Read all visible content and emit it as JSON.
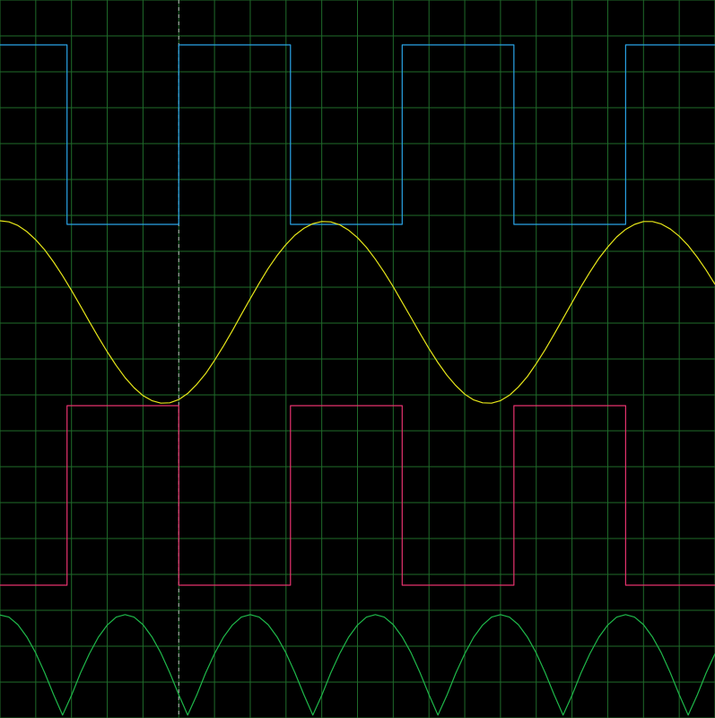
{
  "background_color": "#000000",
  "grid_color": "#1f6b2a",
  "cursor_color": "#bbbbbb",
  "chart_data": {
    "type": "line",
    "grid": true,
    "grid_divisions": {
      "x": 20,
      "y": 20
    },
    "cursor_x": 5,
    "xlim": [
      0,
      20
    ],
    "ylim": [
      0,
      20
    ],
    "series": [
      {
        "id": "square-blue",
        "color": "#29a3e6",
        "points": [
          [
            0,
            18.75
          ],
          [
            1.875,
            18.75
          ],
          [
            1.875,
            13.75
          ],
          [
            5,
            13.75
          ],
          [
            5,
            18.75
          ],
          [
            8.125,
            18.75
          ],
          [
            8.125,
            13.75
          ],
          [
            11.25,
            13.75
          ],
          [
            11.25,
            18.75
          ],
          [
            14.375,
            18.75
          ],
          [
            14.375,
            13.75
          ],
          [
            17.5,
            13.75
          ],
          [
            17.5,
            18.75
          ],
          [
            20,
            18.75
          ]
        ]
      },
      {
        "id": "sine-yellow",
        "color": "#e6e619",
        "points": [
          [
            0.0,
            13.85
          ],
          [
            0.25,
            13.82
          ],
          [
            0.5,
            13.72
          ],
          [
            0.75,
            13.55
          ],
          [
            1.0,
            13.32
          ],
          [
            1.25,
            13.04
          ],
          [
            1.5,
            12.7
          ],
          [
            1.75,
            12.32
          ],
          [
            2.0,
            11.91
          ],
          [
            2.25,
            11.48
          ],
          [
            2.5,
            11.04
          ],
          [
            2.75,
            10.61
          ],
          [
            3.0,
            10.2
          ],
          [
            3.25,
            9.82
          ],
          [
            3.5,
            9.48
          ],
          [
            3.75,
            9.2
          ],
          [
            4.0,
            8.98
          ],
          [
            4.25,
            8.84
          ],
          [
            4.5,
            8.77
          ],
          [
            4.75,
            8.78
          ],
          [
            5.0,
            8.87
          ],
          [
            5.25,
            9.04
          ],
          [
            5.5,
            9.29
          ],
          [
            5.75,
            9.59
          ],
          [
            6.0,
            9.96
          ],
          [
            6.25,
            10.36
          ],
          [
            6.5,
            10.79
          ],
          [
            6.75,
            11.24
          ],
          [
            7.0,
            11.68
          ],
          [
            7.25,
            12.11
          ],
          [
            7.5,
            12.52
          ],
          [
            7.75,
            12.88
          ],
          [
            8.0,
            13.19
          ],
          [
            8.25,
            13.45
          ],
          [
            8.5,
            13.64
          ],
          [
            8.75,
            13.77
          ],
          [
            9.0,
            13.83
          ],
          [
            9.25,
            13.82
          ],
          [
            9.5,
            13.74
          ],
          [
            9.75,
            13.59
          ],
          [
            10.0,
            13.38
          ],
          [
            10.25,
            13.11
          ],
          [
            10.5,
            12.78
          ],
          [
            10.75,
            12.41
          ],
          [
            11.0,
            12.01
          ],
          [
            11.25,
            11.58
          ],
          [
            11.5,
            11.15
          ],
          [
            11.75,
            10.71
          ],
          [
            12.0,
            10.29
          ],
          [
            12.25,
            9.9
          ],
          [
            12.5,
            9.55
          ],
          [
            12.75,
            9.26
          ],
          [
            13.0,
            9.02
          ],
          [
            13.25,
            8.86
          ],
          [
            13.5,
            8.78
          ],
          [
            13.75,
            8.77
          ],
          [
            14.0,
            8.84
          ],
          [
            14.25,
            8.99
          ],
          [
            14.5,
            9.22
          ],
          [
            14.75,
            9.51
          ],
          [
            15.0,
            9.87
          ],
          [
            15.25,
            10.26
          ],
          [
            15.5,
            10.69
          ],
          [
            15.75,
            11.13
          ],
          [
            16.0,
            11.57
          ],
          [
            16.25,
            12.01
          ],
          [
            16.5,
            12.42
          ],
          [
            16.75,
            12.8
          ],
          [
            17.0,
            13.12
          ],
          [
            17.25,
            13.4
          ],
          [
            17.5,
            13.61
          ],
          [
            17.75,
            13.75
          ],
          [
            18.0,
            13.83
          ],
          [
            18.25,
            13.83
          ],
          [
            18.5,
            13.76
          ],
          [
            18.75,
            13.62
          ],
          [
            19.0,
            13.42
          ],
          [
            19.25,
            13.16
          ],
          [
            19.5,
            12.84
          ],
          [
            19.75,
            12.48
          ],
          [
            20.0,
            12.08
          ]
        ]
      },
      {
        "id": "square-pink",
        "color": "#e6326e",
        "points": [
          [
            0,
            3.7
          ],
          [
            1.875,
            3.7
          ],
          [
            1.875,
            8.7
          ],
          [
            5,
            8.7
          ],
          [
            5,
            3.7
          ],
          [
            8.125,
            3.7
          ],
          [
            8.125,
            8.7
          ],
          [
            11.25,
            8.7
          ],
          [
            11.25,
            3.7
          ],
          [
            14.375,
            3.7
          ],
          [
            14.375,
            8.7
          ],
          [
            17.5,
            8.7
          ],
          [
            17.5,
            3.7
          ],
          [
            20,
            3.7
          ]
        ]
      },
      {
        "id": "rectified-green",
        "color": "#1fb84a",
        "points": [
          [
            0.0,
            2.87
          ],
          [
            0.25,
            2.81
          ],
          [
            0.5,
            2.6
          ],
          [
            0.75,
            2.26
          ],
          [
            1.0,
            1.81
          ],
          [
            1.25,
            1.26
          ],
          [
            1.5,
            0.65
          ],
          [
            1.75,
            0.08
          ],
          [
            2.0,
            0.63
          ],
          [
            2.25,
            1.25
          ],
          [
            2.5,
            1.79
          ],
          [
            2.75,
            2.25
          ],
          [
            3.0,
            2.59
          ],
          [
            3.25,
            2.81
          ],
          [
            3.5,
            2.88
          ],
          [
            3.75,
            2.81
          ],
          [
            4.0,
            2.6
          ],
          [
            4.25,
            2.26
          ],
          [
            4.5,
            1.81
          ],
          [
            4.75,
            1.26
          ],
          [
            5.0,
            0.65
          ],
          [
            5.25,
            0.08
          ],
          [
            5.5,
            0.63
          ],
          [
            5.75,
            1.25
          ],
          [
            6.0,
            1.79
          ],
          [
            6.25,
            2.25
          ],
          [
            6.5,
            2.59
          ],
          [
            6.75,
            2.81
          ],
          [
            7.0,
            2.88
          ],
          [
            7.25,
            2.81
          ],
          [
            7.5,
            2.6
          ],
          [
            7.75,
            2.26
          ],
          [
            8.0,
            1.81
          ],
          [
            8.25,
            1.26
          ],
          [
            8.5,
            0.65
          ],
          [
            8.75,
            0.08
          ],
          [
            9.0,
            0.63
          ],
          [
            9.25,
            1.25
          ],
          [
            9.5,
            1.79
          ],
          [
            9.75,
            2.25
          ],
          [
            10.0,
            2.59
          ],
          [
            10.25,
            2.81
          ],
          [
            10.5,
            2.88
          ],
          [
            10.75,
            2.81
          ],
          [
            11.0,
            2.6
          ],
          [
            11.25,
            2.26
          ],
          [
            11.5,
            1.81
          ],
          [
            11.75,
            1.26
          ],
          [
            12.0,
            0.65
          ],
          [
            12.25,
            0.08
          ],
          [
            12.5,
            0.63
          ],
          [
            12.75,
            1.25
          ],
          [
            13.0,
            1.79
          ],
          [
            13.25,
            2.25
          ],
          [
            13.5,
            2.59
          ],
          [
            13.75,
            2.81
          ],
          [
            14.0,
            2.88
          ],
          [
            14.25,
            2.81
          ],
          [
            14.5,
            2.6
          ],
          [
            14.75,
            2.26
          ],
          [
            15.0,
            1.81
          ],
          [
            15.25,
            1.26
          ],
          [
            15.5,
            0.65
          ],
          [
            15.75,
            0.08
          ],
          [
            16.0,
            0.63
          ],
          [
            16.25,
            1.25
          ],
          [
            16.5,
            1.79
          ],
          [
            16.75,
            2.25
          ],
          [
            17.0,
            2.59
          ],
          [
            17.25,
            2.81
          ],
          [
            17.5,
            2.88
          ],
          [
            17.75,
            2.81
          ],
          [
            18.0,
            2.6
          ],
          [
            18.25,
            2.26
          ],
          [
            18.5,
            1.81
          ],
          [
            18.75,
            1.26
          ],
          [
            19.0,
            0.65
          ],
          [
            19.25,
            0.08
          ],
          [
            19.5,
            0.63
          ],
          [
            19.75,
            1.25
          ],
          [
            20.0,
            1.79
          ]
        ]
      }
    ]
  }
}
